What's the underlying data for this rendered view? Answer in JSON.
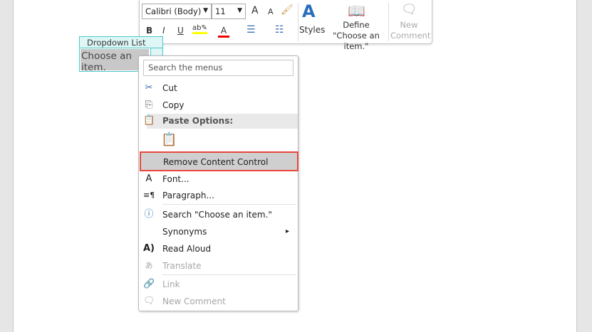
{
  "toolbar": {
    "font_name": "Calibri (Body)",
    "font_size": "11",
    "grow_font": "A",
    "shrink_font": "A",
    "bold": "B",
    "italic": "I",
    "underline": "U",
    "styles_label": "Styles",
    "define_label": "Define \"Choose an item.\"",
    "new_comment_label": "New Comment",
    "highlight_color": "#ffff00",
    "font_color": "#ff0000"
  },
  "control": {
    "title": "Dropdown List",
    "placeholder": "Choose an item."
  },
  "menu": {
    "search_placeholder": "Search the menus",
    "items": [
      {
        "label": "Cut",
        "icon": "scissors-icon"
      },
      {
        "label": "Copy",
        "icon": "copy-icon"
      },
      {
        "label": "Paste Options:",
        "icon": "paste-icon"
      },
      {
        "label": "Remove Content Control"
      },
      {
        "label": "Font...",
        "icon": "font-icon"
      },
      {
        "label": "Paragraph...",
        "icon": "paragraph-icon"
      },
      {
        "label": "Search \"Choose an item.\"",
        "icon": "smart-lookup-icon"
      },
      {
        "label": "Synonyms",
        "submenu": "▸"
      },
      {
        "label": "Read Aloud",
        "icon": "read-aloud-icon"
      },
      {
        "label": "Translate",
        "icon": "translate-icon",
        "disabled": true
      },
      {
        "label": "Link",
        "icon": "link-icon",
        "disabled": true
      },
      {
        "label": "New Comment",
        "icon": "new-comment-icon",
        "disabled": true
      }
    ]
  },
  "highlight_color": "#e8463a"
}
